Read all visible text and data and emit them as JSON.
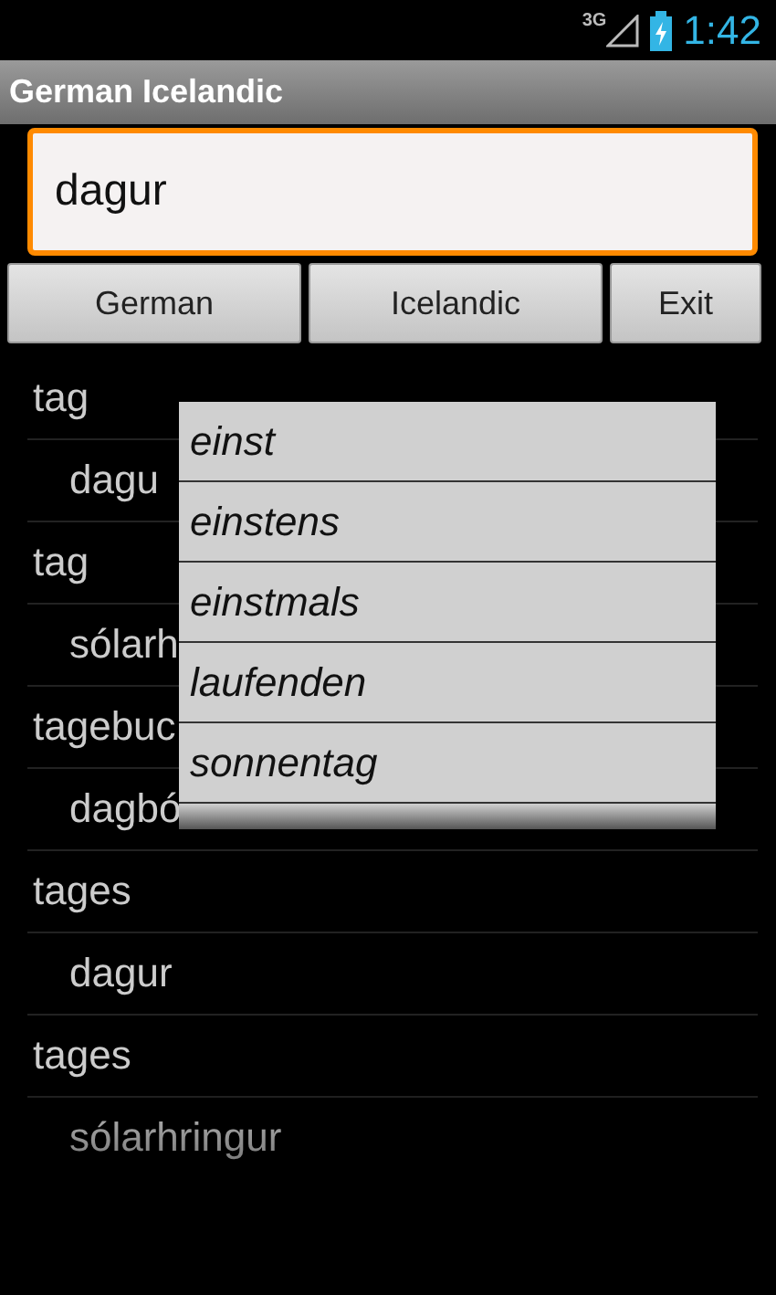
{
  "status_bar": {
    "network": "3G",
    "time": "1:42"
  },
  "title": "German Icelandic",
  "search": {
    "value": "dagur"
  },
  "buttons": [
    "German",
    "Icelandic",
    "Exit"
  ],
  "results": [
    {
      "text": "tag",
      "kind": "term"
    },
    {
      "text": "dagu",
      "kind": "translation"
    },
    {
      "text": "tag",
      "kind": "term"
    },
    {
      "text": "sólarh",
      "kind": "translation"
    },
    {
      "text": "tagebuc",
      "kind": "term"
    },
    {
      "text": "dagbó",
      "kind": "translation"
    },
    {
      "text": "tages",
      "kind": "term"
    },
    {
      "text": "dagur",
      "kind": "translation"
    },
    {
      "text": "tages",
      "kind": "term"
    },
    {
      "text": "sólarhringur",
      "kind": "translation"
    }
  ],
  "suggestions": [
    "einst",
    "einstens",
    "einstmals",
    "laufenden",
    "sonnentag"
  ]
}
